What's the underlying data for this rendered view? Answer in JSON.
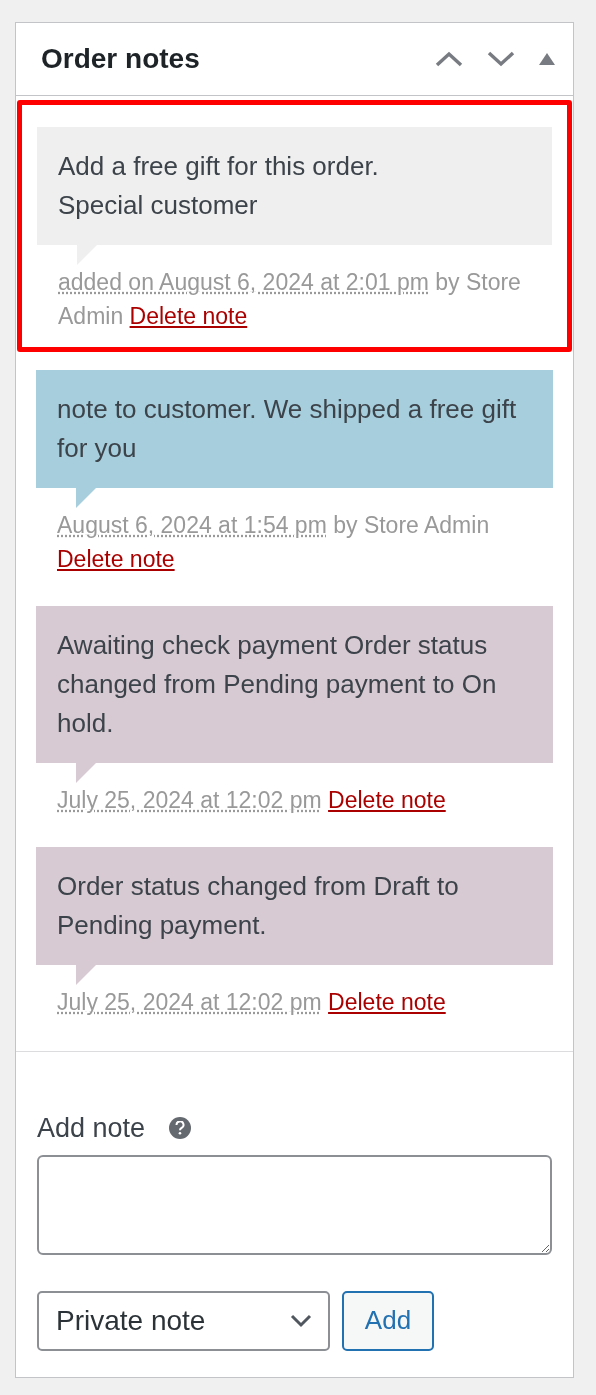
{
  "panel": {
    "title": "Order notes",
    "controls": [
      {
        "kind": "move-up"
      },
      {
        "kind": "move-down"
      },
      {
        "kind": "collapse"
      }
    ]
  },
  "notes": [
    {
      "kind": "private",
      "highlighted": true,
      "text": "Add a free gift for this order.\nSpecial customer",
      "date": "added on August 6, 2024 at 2:01 pm",
      "author": "by Store Admin",
      "delete": "Delete note"
    },
    {
      "kind": "customer",
      "highlighted": false,
      "text": "note to customer. We shipped a free gift for you",
      "date": "August 6, 2024 at 1:54 pm",
      "author": "by Store Admin",
      "delete": "Delete note"
    },
    {
      "kind": "system",
      "highlighted": false,
      "text": "Awaiting check payment Order status changed from Pending payment to On hold.",
      "date": "July 25, 2024 at 12:02 pm",
      "delete": "Delete note"
    },
    {
      "kind": "system",
      "highlighted": false,
      "text": "Order status changed from Draft to Pending payment.",
      "date": "July 25, 2024 at 12:02 pm",
      "delete": "Delete note"
    }
  ],
  "add_note": {
    "label": "Add note",
    "note_type": "Private note",
    "button": "Add"
  }
}
